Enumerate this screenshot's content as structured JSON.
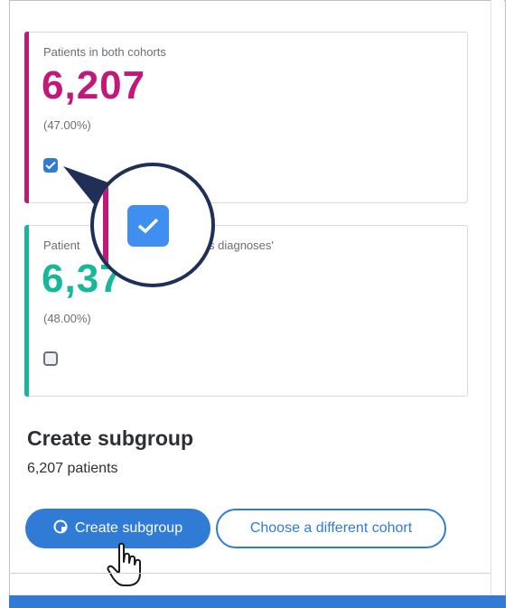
{
  "cards": [
    {
      "title": "Patients in both cohorts",
      "value": "6,207",
      "percent": "(47.00%)",
      "accent_color": "#c2187a",
      "checked": true
    },
    {
      "title_left": "Patient",
      "title_right": "s diagnoses'",
      "value": "6,37",
      "percent": "(48.00%)",
      "accent_color": "#17b79a",
      "checked": false
    }
  ],
  "subgroup": {
    "title": "Create subgroup",
    "count": "6,207 patients"
  },
  "buttons": {
    "create_label": "Create subgroup",
    "choose_label": "Choose a different cohort"
  },
  "icons": {
    "checkbox_check": "check-icon",
    "create_button": "pie-chart-icon",
    "cursor": "hand-pointer-icon"
  },
  "colors": {
    "primary": "#2f7bd6",
    "magenta": "#c2187a",
    "teal": "#17b79a",
    "callout_border": "#1f2f56"
  }
}
